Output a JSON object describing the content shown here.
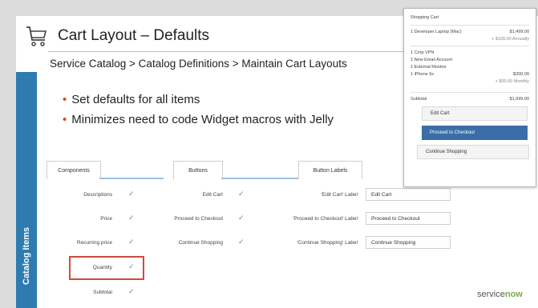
{
  "slide": {
    "title": "Cart Layout – Defaults",
    "breadcrumb": "Service Catalog > Catalog Definitions > Maintain Cart Layouts",
    "bullets": [
      "Set defaults for all items",
      "Minimizes need to code Widget macros with Jelly"
    ],
    "sidebar_label": "Catalog Items",
    "logo": {
      "prefix": "service",
      "suffix": "now"
    }
  },
  "config": {
    "tabs": [
      "Components",
      "Buttons",
      "Button Labels"
    ],
    "components": [
      {
        "label": "Descriptions"
      },
      {
        "label": "Price"
      },
      {
        "label": "Recurring price"
      },
      {
        "label": "Quantity"
      },
      {
        "label": "Subtotal"
      }
    ],
    "buttons": [
      {
        "label": "Edit Cart"
      },
      {
        "label": "Proceed to Checkout"
      },
      {
        "label": "Continue Shopping"
      }
    ],
    "button_labels": [
      {
        "label": "'Edit Cart' Label",
        "value": "Edit Cart"
      },
      {
        "label": "'Proceed to Checkout' Label",
        "value": "Proceed to Checkout"
      },
      {
        "label": "'Continue Shopping' Label",
        "value": "Continue Shopping"
      }
    ],
    "check_glyph": "✓"
  },
  "cart": {
    "title": "Shopping Cart",
    "item1": "1 Developer Laptop (Mac)",
    "item1_price": "$1,499.00",
    "item1_sub": "+ $100.00 Annually",
    "items": [
      "1 Corp VPN",
      "1 New Email Account",
      "1 External Monitor",
      "1 iPhone 6s"
    ],
    "item4_price": "$300.00",
    "item4_sub": "+ $00.00 Monthly",
    "subtotal_label": "Subtotal",
    "subtotal_value": "$1,999.00",
    "edit_label": "Edit Cart",
    "checkout_label": "Proceed to Checkout",
    "continue_label": "Continue Shopping"
  },
  "colors": {
    "accent": "#2d7bb0",
    "highlight": "#d24a40",
    "primary_button": "#3b6ea8",
    "brand_green": "#7aa84a"
  }
}
